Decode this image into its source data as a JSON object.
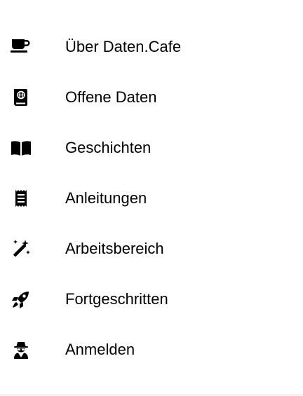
{
  "menu": {
    "items": [
      {
        "label": "Über Daten.Cafe",
        "icon": "coffee-cup-icon"
      },
      {
        "label": "Offene Daten",
        "icon": "atlas-book-icon"
      },
      {
        "label": "Geschichten",
        "icon": "open-book-icon"
      },
      {
        "label": "Anleitungen",
        "icon": "receipt-icon"
      },
      {
        "label": "Arbeitsbereich",
        "icon": "magic-wand-icon"
      },
      {
        "label": "Fortgeschritten",
        "icon": "rocket-icon"
      },
      {
        "label": "Anmelden",
        "icon": "user-secret-icon"
      }
    ]
  }
}
